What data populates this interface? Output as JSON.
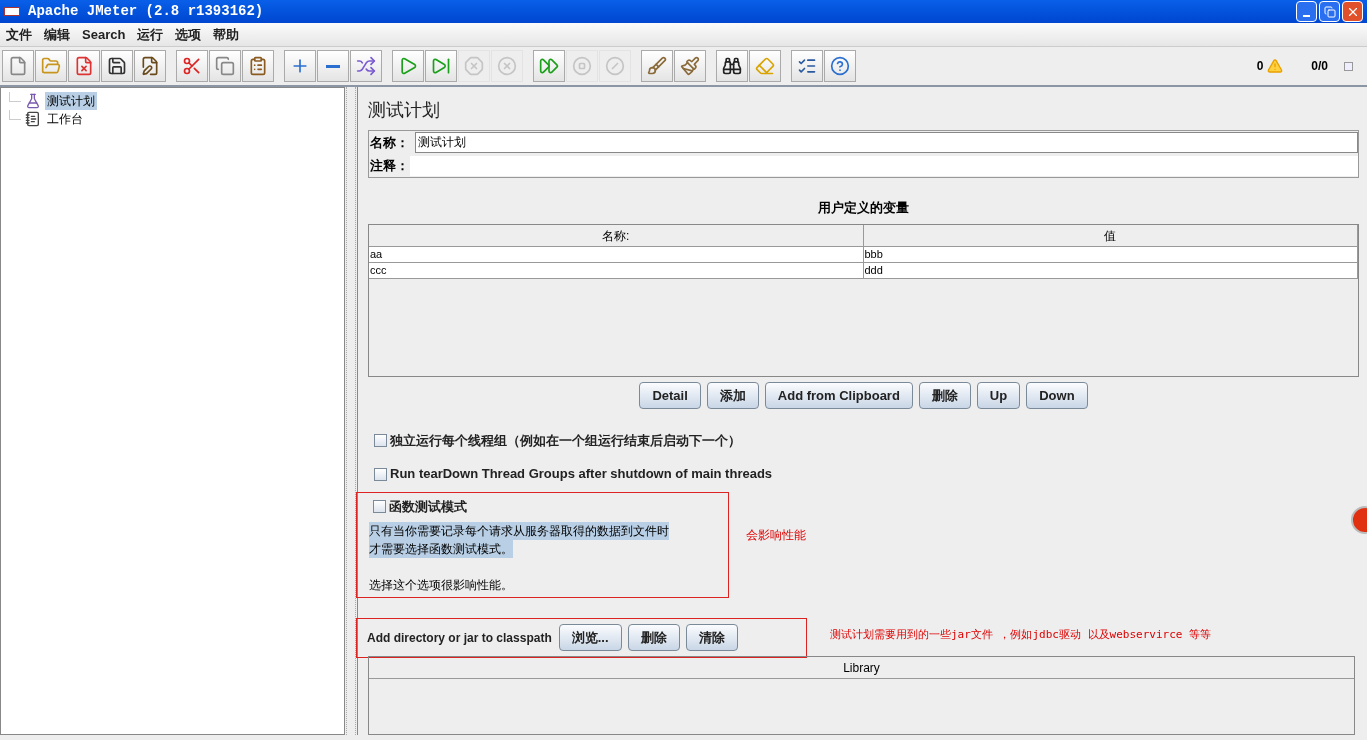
{
  "window": {
    "title": "Apache JMeter (2.8 r1393162)"
  },
  "menu": [
    "文件",
    "编辑",
    "Search",
    "运行",
    "选项",
    "帮助"
  ],
  "toolbar": [
    [
      {
        "kind": "new",
        "disabled": false
      },
      {
        "kind": "open",
        "disabled": false
      },
      {
        "kind": "close",
        "disabled": false
      },
      {
        "kind": "save",
        "disabled": false
      },
      {
        "kind": "saveas",
        "disabled": false
      }
    ],
    [
      {
        "kind": "cut",
        "disabled": false
      },
      {
        "kind": "copy",
        "disabled": false
      },
      {
        "kind": "paste",
        "disabled": false
      }
    ],
    [
      {
        "kind": "expand",
        "disabled": false
      },
      {
        "kind": "collapse",
        "disabled": false
      },
      {
        "kind": "toggle",
        "disabled": false
      }
    ],
    [
      {
        "kind": "start",
        "disabled": false
      },
      {
        "kind": "startnopause",
        "disabled": false
      },
      {
        "kind": "stop",
        "disabled": true
      },
      {
        "kind": "shutdown",
        "disabled": true
      }
    ],
    [
      {
        "kind": "remotestart",
        "disabled": false
      },
      {
        "kind": "remotestop",
        "disabled": true
      },
      {
        "kind": "remoteshutdown",
        "disabled": true
      }
    ],
    [
      {
        "kind": "clear",
        "disabled": false
      },
      {
        "kind": "clearall",
        "disabled": false
      }
    ],
    [
      {
        "kind": "search",
        "disabled": false
      },
      {
        "kind": "reset",
        "disabled": false
      }
    ],
    [
      {
        "kind": "functions",
        "disabled": false
      },
      {
        "kind": "help",
        "disabled": false
      }
    ]
  ],
  "status": {
    "errors": "0",
    "threads": "0/0"
  },
  "tree": [
    {
      "label": "测试计划",
      "selected": true,
      "kind": "plan"
    },
    {
      "label": "工作台",
      "selected": false,
      "kind": "workbench"
    }
  ],
  "panel": {
    "title": "测试计划",
    "name_label": "名称：",
    "name_value": "测试计划",
    "comment_label": "注释：",
    "variables": {
      "title": "用户定义的变量",
      "columns": [
        "名称:",
        "值"
      ],
      "rows": [
        [
          "aa",
          "bbb"
        ],
        [
          "ccc",
          "ddd"
        ]
      ]
    },
    "buttons": [
      "Detail",
      "添加",
      "Add from Clipboard",
      "删除",
      "Up",
      "Down"
    ],
    "options": [
      {
        "label": "独立运行每个线程组（例如在一个组运行结束后启动下一个）",
        "checked": false
      },
      {
        "label": "Run tearDown Thread Groups after shutdown of main threads",
        "checked": false
      }
    ],
    "functional": {
      "label": "函数测试模式",
      "checked": false,
      "description": [
        {
          "text": "只有当你需要记录每个请求从服务器取得的数据到文件时",
          "selected": true
        },
        {
          "text": "才需要选择函数测试模式。",
          "selected": true
        },
        {
          "text": "选择这个选项很影响性能。",
          "selected": false
        }
      ],
      "annotation": "会影响性能"
    },
    "classpath": {
      "label": "Add directory or jar to classpath",
      "buttons": [
        "浏览...",
        "删除",
        "清除"
      ],
      "annotation": "测试计划需要用到的一些jar文件 ，例如jdbc驱动 以及webservirce 等等",
      "columns": [
        "Library"
      ]
    }
  }
}
